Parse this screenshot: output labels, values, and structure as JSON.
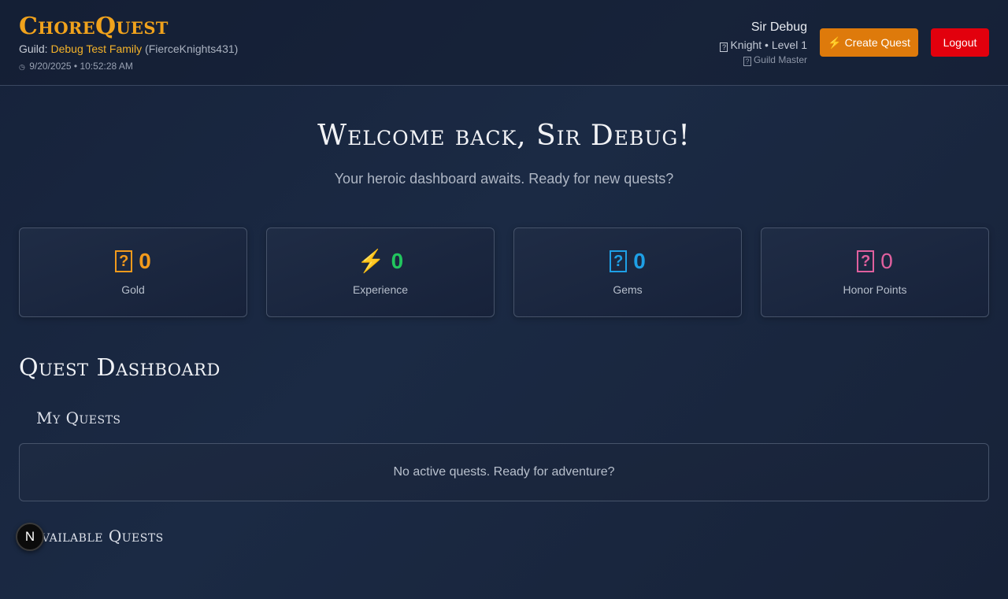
{
  "header": {
    "brand": "ChoreQuest",
    "guild_prefix": "Guild: ",
    "guild_name": "Debug Test Family",
    "guild_code": "(FierceKnights431)",
    "datetime": "9/20/2025 • 10:52:28 AM",
    "user_name": "Sir Debug",
    "user_class": "Knight • Level 1",
    "user_role": "Guild Master",
    "create_quest_label": "Create Quest",
    "logout_label": "Logout"
  },
  "welcome": {
    "title": "Welcome back, Sir Debug!",
    "subtitle": "Your heroic dashboard awaits. Ready for new quests?"
  },
  "stats": [
    {
      "icon": "gold-icon",
      "value": "0",
      "label": "Gold",
      "color": "#f29a1c"
    },
    {
      "icon": "experience-icon",
      "value": "0",
      "label": "Experience",
      "color": "#22c55e"
    },
    {
      "icon": "gems-icon",
      "value": "0",
      "label": "Gems",
      "color": "#1ea0e6"
    },
    {
      "icon": "honor-icon",
      "value": "0",
      "label": "Honor Points",
      "color": "#e0609e"
    }
  ],
  "dashboard": {
    "title": "Quest Dashboard",
    "my_quests_title": "My Quests",
    "my_quests_empty": "No active quests. Ready for adventure?",
    "available_quests_title": "Available Quests"
  },
  "badge": {
    "letter": "N"
  },
  "colors": {
    "brand": "#f0a21c",
    "create_button": "#de7a0b",
    "logout_button": "#e2000d"
  }
}
